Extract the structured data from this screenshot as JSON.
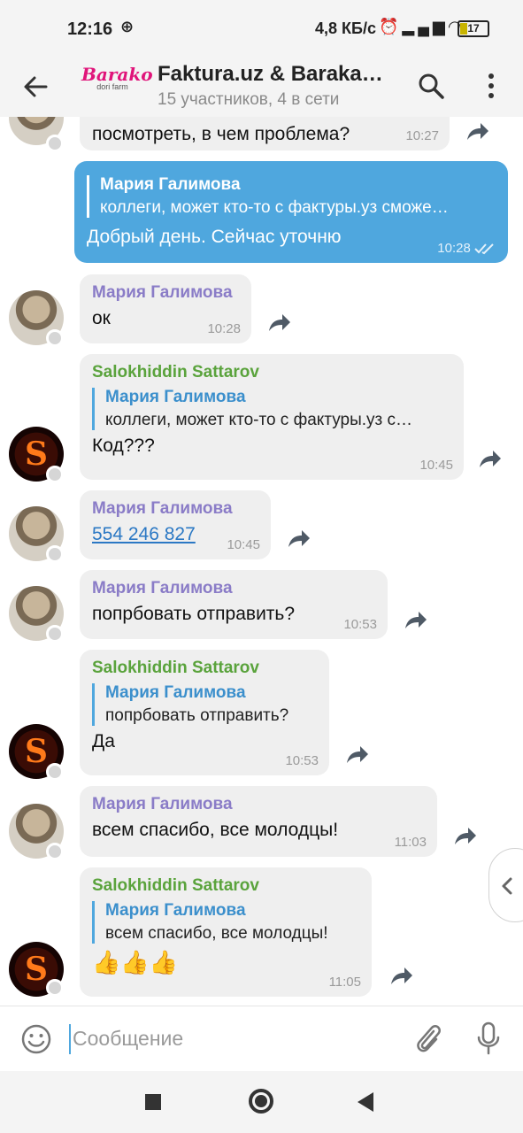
{
  "status_bar": {
    "time": "12:16",
    "speed": "4,8 КБ/с",
    "battery": "17"
  },
  "header": {
    "logo_text": "Barako",
    "logo_subtext": "dori farm",
    "title": "Faktura.uz & Baraka…",
    "subtitle": "15 участников, 4 в сети"
  },
  "messages": [
    {
      "text": "посмотреть, в чем проблема?",
      "time": "10:27"
    },
    {
      "reply_name": "Мария Галимова",
      "reply_text": "коллеги, может кто-то с фактуры.уз сможе…",
      "text": "Добрый день. Сейчас уточню",
      "time": "10:28"
    },
    {
      "sender": "Мария Галимова",
      "text": "ок",
      "time": "10:28"
    },
    {
      "sender": "Salokhiddin Sattarov",
      "reply_name": "Мария Галимова",
      "reply_text": "коллеги, может кто-то с фактуры.уз с…",
      "text": "Код???",
      "time": "10:45"
    },
    {
      "sender": "Мария Галимова",
      "text": "554 246 827",
      "time": "10:45"
    },
    {
      "sender": "Мария Галимова",
      "text": "попрбовать отправить?",
      "time": "10:53"
    },
    {
      "sender": "Salokhiddin Sattarov",
      "reply_name": "Мария Галимова",
      "reply_text": "попрбовать отправить?",
      "text": "Да",
      "time": "10:53"
    },
    {
      "sender": "Мария Галимова",
      "text": "всем спасибо, все молодцы!",
      "time": "11:03"
    },
    {
      "sender": "Salokhiddin Sattarov",
      "reply_name": "Мария Галимова",
      "reply_text": "всем спасибо, все молодцы!",
      "text": "👍👍👍",
      "time": "11:05"
    }
  ],
  "avatars": {
    "salokhiddin_letter": "S"
  },
  "input": {
    "placeholder": "Сообщение"
  },
  "icons": {
    "back": "arrow-left-icon",
    "search": "search-icon",
    "menu": "more-vertical-icon",
    "share": "share-arrow-icon",
    "emoji": "smile-icon",
    "attach": "paperclip-icon",
    "mic": "microphone-icon",
    "read": "double-check-icon",
    "side": "chevron-left-icon"
  },
  "colors": {
    "outgoing_bubble": "#4fa7de",
    "incoming_bubble": "#efefef",
    "sender_maria": "#8a7cc7",
    "sender_salokhiddin": "#5aa33c",
    "reply_name": "#3b8fcc",
    "brand_logo": "#e0147a"
  }
}
